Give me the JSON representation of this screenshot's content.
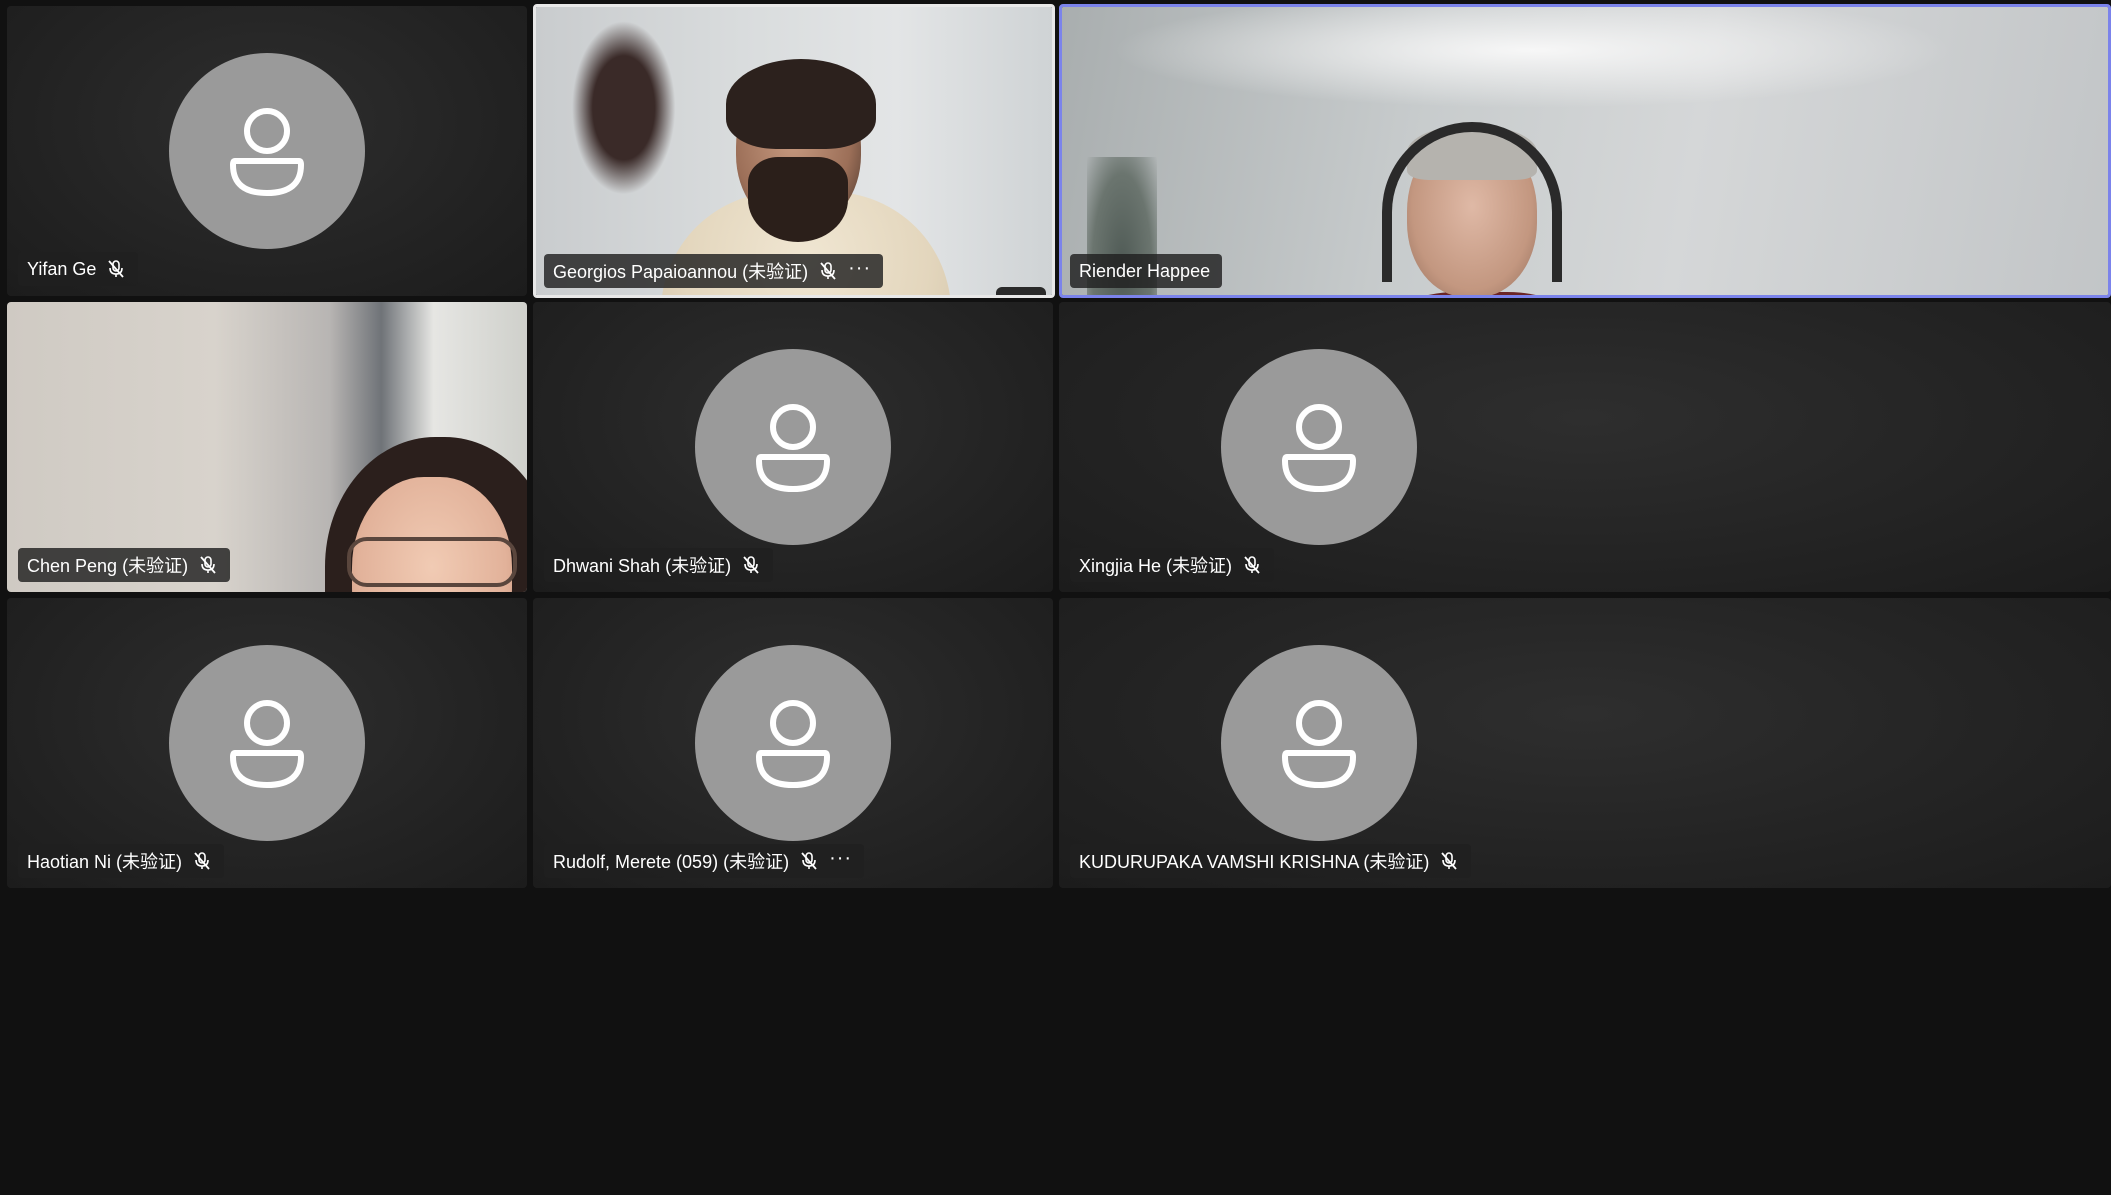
{
  "participants": [
    {
      "name": "Yifan Ge",
      "muted": true,
      "video": false,
      "more": false
    },
    {
      "name": "Georgios Papaioannou (未验证)",
      "muted": true,
      "video": true,
      "more": true
    },
    {
      "name": "Riender Happee",
      "muted": false,
      "video": true,
      "more": false,
      "active_speaker": true
    },
    {
      "name": "Chen Peng (未验证)",
      "muted": true,
      "video": true,
      "more": false
    },
    {
      "name": "Dhwani Shah (未验证)",
      "muted": true,
      "video": false,
      "more": false
    },
    {
      "name": "Xingjia He (未验证)",
      "muted": true,
      "video": false,
      "more": false
    },
    {
      "name": "Haotian Ni (未验证)",
      "muted": true,
      "video": false,
      "more": false
    },
    {
      "name": "Rudolf, Merete (059) (未验证)",
      "muted": true,
      "video": false,
      "more": true
    },
    {
      "name": "KUDURUPAKA VAMSHI KRISHNA (未验证)",
      "muted": true,
      "video": false,
      "more": false
    }
  ],
  "icons": {
    "avatar": "person-avatar-icon",
    "mic": "mic-off-icon",
    "more": "more-options-icon"
  },
  "colors": {
    "active_border": "#7b83eb",
    "video_border": "#e8e8e8",
    "avatar_bg": "#9a9a9a",
    "tile_bg": "#242424"
  },
  "more_glyph": "···"
}
